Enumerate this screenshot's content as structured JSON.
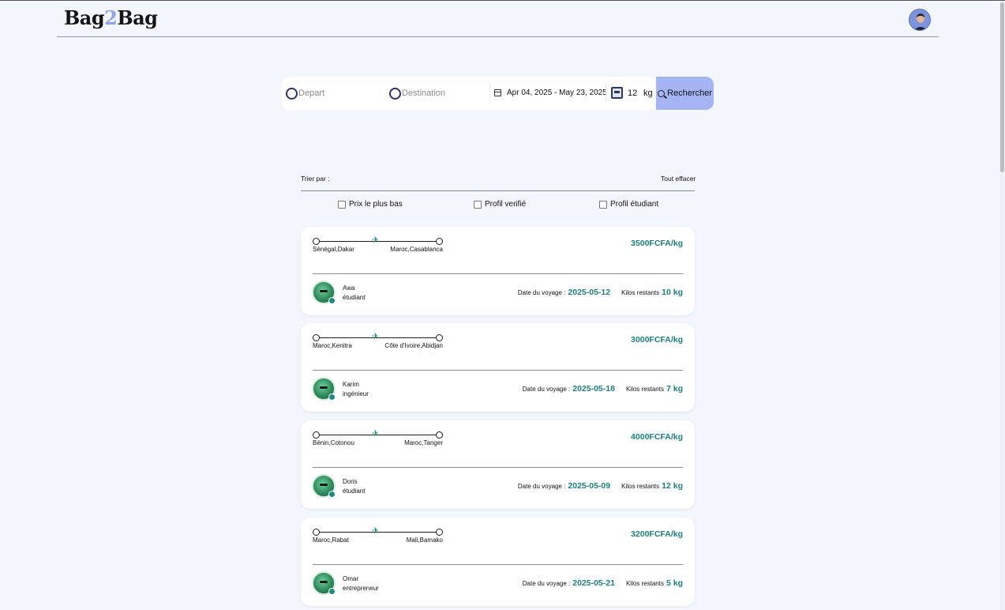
{
  "header": {
    "logo_left": "Bag",
    "logo_mid": "2",
    "logo_right": "Bag"
  },
  "search": {
    "departure_placeholder": "Depart",
    "destination_placeholder": "Destination",
    "date_range": "Apr 04, 2025 - May 23, 2025",
    "weight_value": "12",
    "weight_unit": "kg",
    "button_label": "Rechercher"
  },
  "sort": {
    "label": "Trier par :",
    "clear_label": "Tout effacer",
    "filters": [
      {
        "label": "Prix le plus bas",
        "checked": false
      },
      {
        "label": "Profil verifié",
        "checked": false
      },
      {
        "label": "Profil étudiant",
        "checked": false
      }
    ]
  },
  "listings": [
    {
      "from": "Sénégal,Dakar",
      "to": "Maroc,Casablanca",
      "price": "3500FCFA/kg",
      "name": "Awa",
      "role": "étudiant",
      "date_label": "Date du voyage :",
      "date": "2025-05-12",
      "kilos_label": "Kilos restants",
      "kilos": "10 kg"
    },
    {
      "from": "Maroc,Kenitra",
      "to": "Côte d'Ivoire,Abidjan",
      "price": "3000FCFA/kg",
      "name": "Karim",
      "role": "ingénieur",
      "date_label": "Date du voyage :",
      "date": "2025-05-18",
      "kilos_label": "Kilos restants",
      "kilos": "7 kg"
    },
    {
      "from": "Bénin,Cotonou",
      "to": "Maroc,Tanger",
      "price": "4000FCFA/kg",
      "name": "Doris",
      "role": "étudiant",
      "date_label": "Date du voyage :",
      "date": "2025-05-09",
      "kilos_label": "Kilos restants",
      "kilos": "12 kg"
    },
    {
      "from": "Maroc,Rabat",
      "to": "Mali,Bamako",
      "price": "3200FCFA/kg",
      "name": "Omar",
      "role": "entrepreneur",
      "date_label": "Date du voyage :",
      "date": "2025-05-21",
      "kilos_label": "Kilos restants",
      "kilos": "5 kg"
    }
  ],
  "colors": {
    "accent_teal": "#1f7d7a",
    "search_button": "#a5b4f4",
    "background": "#f3f6fd"
  }
}
